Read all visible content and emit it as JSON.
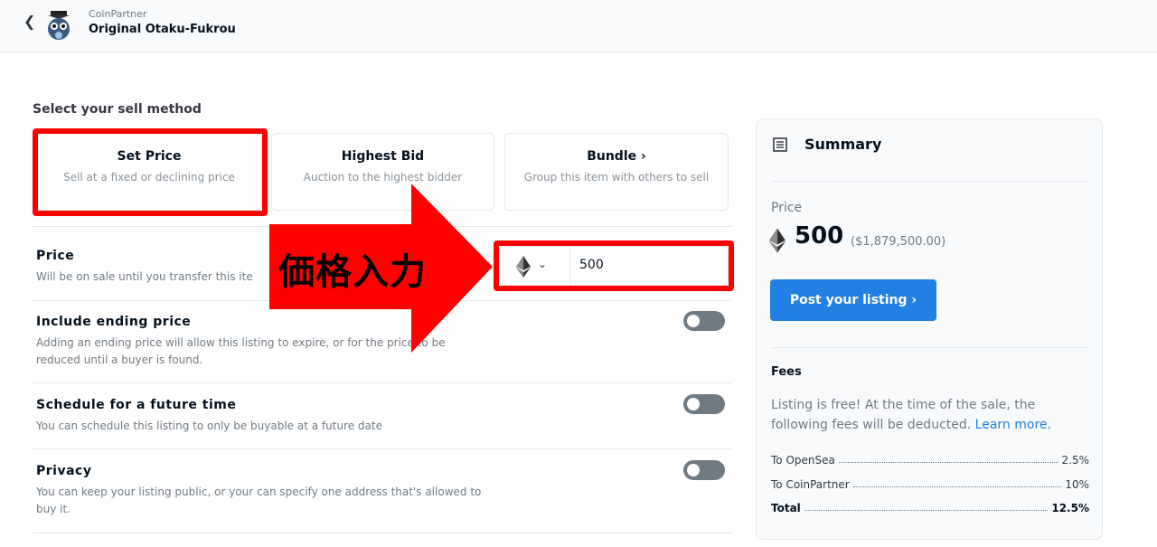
{
  "header": {
    "back_icon": "chevron-left-icon",
    "collection": "CoinPartner",
    "item_name": "Original Otaku-Fukrou"
  },
  "sell_method": {
    "title": "Select your sell method",
    "options": [
      {
        "label": "Set Price",
        "desc": "Sell at a fixed or declining price"
      },
      {
        "label": "Highest Bid",
        "desc": "Auction to the highest bidder"
      },
      {
        "label": "Bundle ›",
        "desc": "Group this item with others to sell"
      }
    ]
  },
  "price": {
    "title": "Price",
    "desc": "Will be on sale until you transfer this ite",
    "currency_icon": "ethereum-icon",
    "value": "500"
  },
  "ending_price": {
    "title": "Include ending price",
    "desc": "Adding an ending price will allow this listing to expire, or for the price to be reduced until a buyer is found."
  },
  "schedule": {
    "title": "Schedule for a future time",
    "desc": "You can schedule this listing to only be buyable at a future date"
  },
  "privacy": {
    "title": "Privacy",
    "desc": "You can keep your listing public, or your can specify one address that's allowed to buy it."
  },
  "annotation": {
    "text": "価格入力",
    "color": "#ff0000"
  },
  "summary": {
    "title": "Summary",
    "price_label": "Price",
    "amount": "500",
    "usd": "($1,879,500.00)",
    "post_button": "Post your listing ›",
    "fees_title": "Fees",
    "fees_text": "Listing is free! At the time of the sale, the following fees will be deducted.",
    "learn_more": "Learn more.",
    "fees": [
      {
        "name": "To OpenSea",
        "value": "2.5%"
      },
      {
        "name": "To CoinPartner",
        "value": "10%"
      },
      {
        "name": "Total",
        "value": "12.5%"
      }
    ]
  },
  "colors": {
    "accent": "#2081e2",
    "annotation_red": "#ff0000",
    "toggle_off": "#707a83"
  }
}
